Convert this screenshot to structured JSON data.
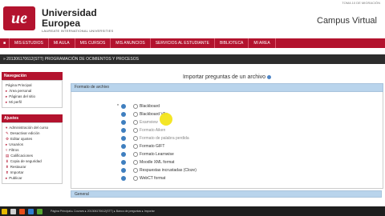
{
  "header": {
    "logo_text": "ue",
    "university_line1": "Universidad",
    "university_line2": "Europea",
    "tagline": "LAUREATE INTERNATIONAL UNIVERSITIES",
    "campus_title": "Campus Virtual",
    "top_right_tag": "TOMA 10 DE MIGRACIÓN"
  },
  "navbar": {
    "items": [
      "MIS ESTUDIOS",
      "MI AULA",
      "MIS CURSOS",
      "MIS ANUNCIOS",
      "SERVICIOS AL ESTUDIANTE",
      "BIBLIOTECA",
      "MI AREA"
    ]
  },
  "breadcrumb": "» 201306170612(STT)  PROGRAMACIÓN DE OCIMIENTOS Y PROCESOS",
  "left": {
    "navigation_title": "Navegación",
    "navigation_items": [
      "Página Principal",
      "Área personal",
      "Páginas del sitio",
      "Mi perfil"
    ],
    "ajustes_title": "Ajustes",
    "ajustes_items": [
      "Administración del curso",
      "Desactivar edición",
      "Editar ajustes",
      "Usuarios",
      "Filtros",
      "Calificaciones",
      "Copia de seguridad",
      "Restaurar",
      "Importar",
      "Publicar"
    ]
  },
  "main": {
    "page_title": "Importar preguntas de un archivo",
    "format_section_title": "Formato de archivo",
    "formats": [
      {
        "label": "Blackboard",
        "dim": false
      },
      {
        "label": "Blackboard V6+",
        "dim": false
      },
      {
        "label": "Examview",
        "dim": true
      },
      {
        "label": "Formato Aiken",
        "dim": true
      },
      {
        "label": "Formato de palabra perdida",
        "dim": true
      },
      {
        "label": "Formato GIFT",
        "dim": false
      },
      {
        "label": "Formato Learnwise",
        "dim": false
      },
      {
        "label": "Moodle XML format",
        "dim": false
      },
      {
        "label": "Respuestas incrustadas (Cloze)",
        "dim": false
      },
      {
        "label": "WebCT format",
        "dim": false
      }
    ],
    "required_marker": "*",
    "general_section_title": "General"
  },
  "taskbar": {
    "status_text": "Página Principal ▸ Courses ▸ 201306170612(STT) ▸ Banco de preguntas ▸ Importar"
  },
  "colors": {
    "brand": "#b3132e",
    "section_blue": "#b9d4ec",
    "icon_blue": "#3f7fbf",
    "cursor_highlight": "#f3e51a"
  }
}
